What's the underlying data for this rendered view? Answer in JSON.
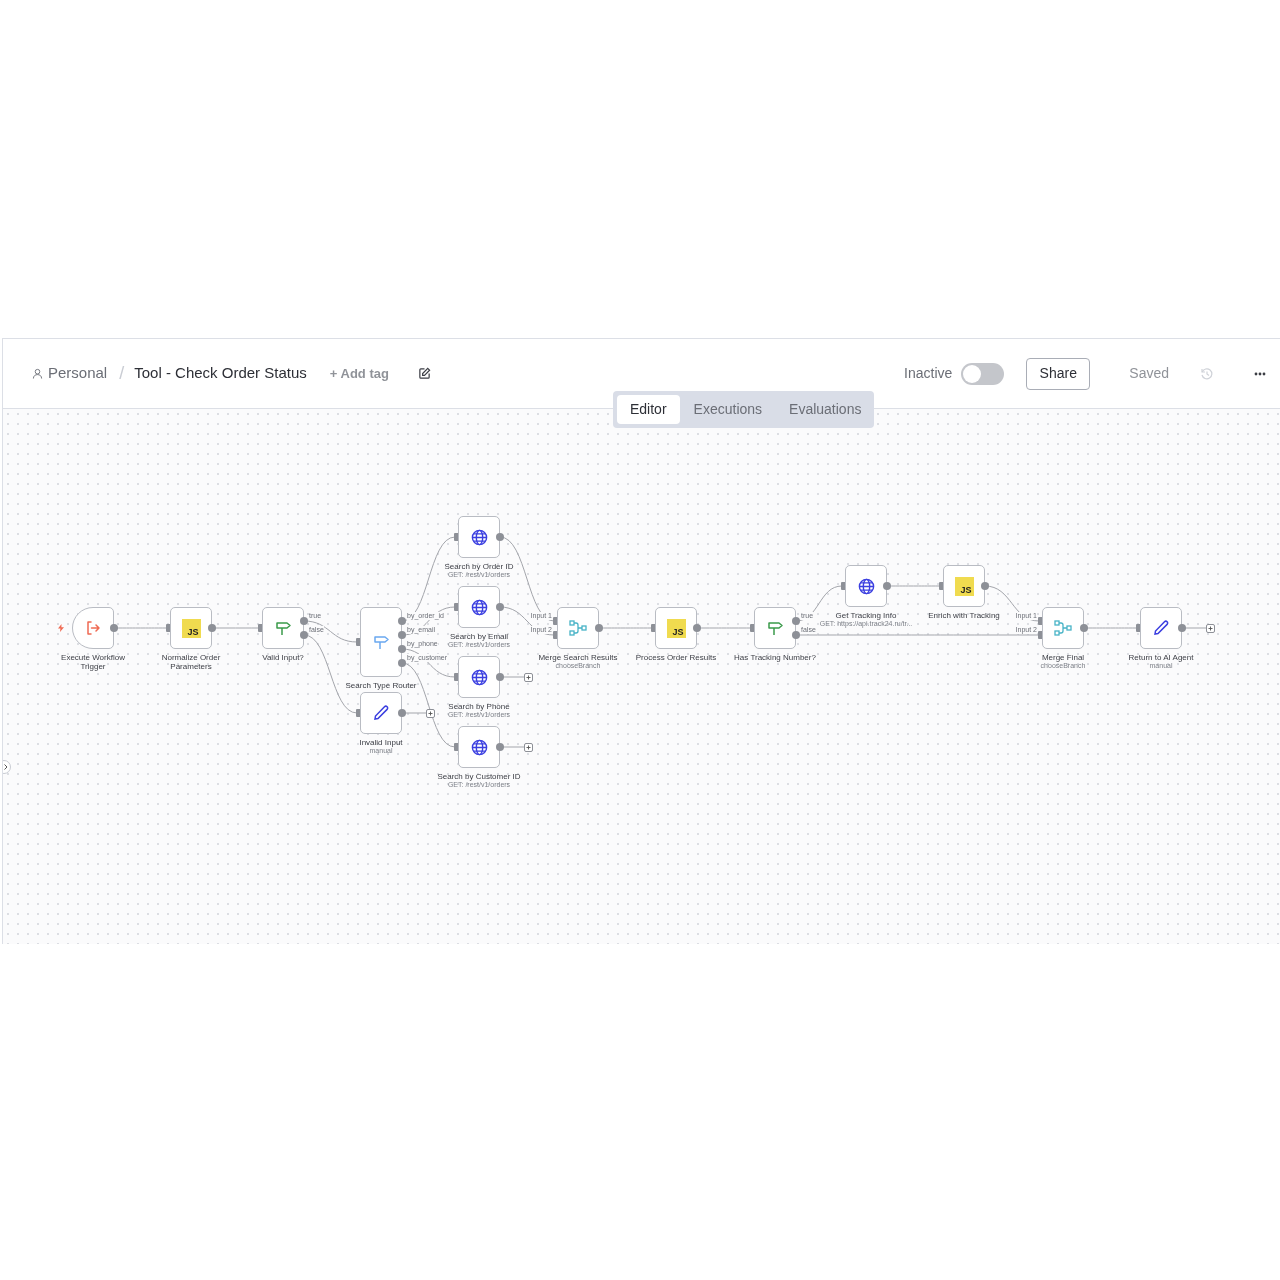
{
  "breadcrumb": {
    "project": "Personal",
    "separator": "/",
    "workflow": "Tool - Check Order Status"
  },
  "add_tag": "+ Add tag",
  "activation": {
    "label": "Inactive",
    "active": false
  },
  "share_button": "Share",
  "save_state": "Saved",
  "tabs": [
    {
      "label": "Editor",
      "selected": true
    },
    {
      "label": "Executions",
      "selected": false
    },
    {
      "label": "Evaluations",
      "selected": false
    }
  ],
  "nodes": [
    {
      "kind": "trigger",
      "label": "Execute Workflow Trigger"
    },
    {
      "kind": "code",
      "label": "Normalize Order Parameters",
      "badge": "JS"
    },
    {
      "kind": "if",
      "label": "Valid Input?",
      "outputs": [
        "true",
        "false"
      ]
    },
    {
      "kind": "switch",
      "label": "Search Type Router",
      "outputs": [
        "by_order_id",
        "by_email",
        "by_phone",
        "by_customer"
      ]
    },
    {
      "kind": "set",
      "label": "Invalid Input",
      "subtitle": "manual"
    },
    {
      "kind": "http",
      "label": "Search by Order ID",
      "subtitle": "GET: /rest/v1/orders"
    },
    {
      "kind": "http",
      "label": "Search by Email",
      "subtitle": "GET: /rest/v1/orders"
    },
    {
      "kind": "http",
      "label": "Search by Phone",
      "subtitle": "GET: /rest/v1/orders"
    },
    {
      "kind": "http",
      "label": "Search by Customer ID",
      "subtitle": "GET: /rest/v1/orders"
    },
    {
      "kind": "merge",
      "label": "Merge Search Results",
      "subtitle": "chooseBranch",
      "inputs": [
        "Input 1",
        "Input 2"
      ]
    },
    {
      "kind": "code",
      "label": "Process Order Results",
      "badge": "JS"
    },
    {
      "kind": "if",
      "label": "Has Tracking Number?",
      "outputs": [
        "true",
        "false"
      ]
    },
    {
      "kind": "http",
      "label": "Get Tracking Info",
      "subtitle": "GET: https://api.track24.ru/tr..."
    },
    {
      "kind": "code",
      "label": "Enrich with Tracking",
      "badge": "JS"
    },
    {
      "kind": "merge",
      "label": "Merge Final",
      "subtitle": "chooseBranch",
      "inputs": [
        "Input 1",
        "Input 2"
      ]
    },
    {
      "kind": "set",
      "label": "Return to AI Agent",
      "subtitle": "manual"
    }
  ]
}
